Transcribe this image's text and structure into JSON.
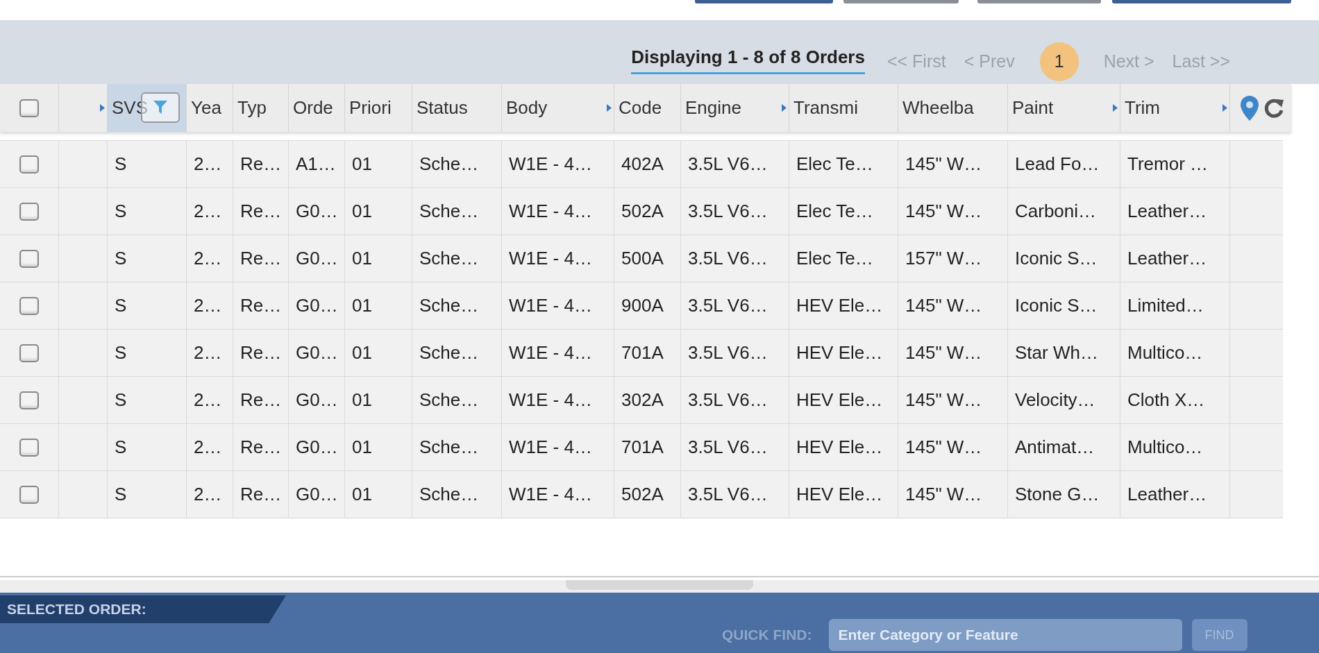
{
  "top_buttons": [
    {
      "kind": "primary"
    },
    {
      "kind": "secondary"
    },
    {
      "kind": "secondary"
    },
    {
      "kind": "primary"
    }
  ],
  "pager": {
    "summary": "Displaying 1 - 8 of 8 Orders",
    "first": "<< First",
    "prev": "< Prev",
    "pages": [
      {
        "label": "1",
        "selected": true
      }
    ],
    "next": "Next >",
    "last": "Last >>"
  },
  "table": {
    "header_checked": false,
    "columns": [
      {
        "sort_arrow": true,
        "selected": false
      },
      {
        "label": "SVS",
        "sort_arrow": false,
        "selected": true
      },
      {
        "label": "Yea",
        "sort_arrow": false,
        "selected": false
      },
      {
        "label": "Typ",
        "sort_arrow": false,
        "selected": false
      },
      {
        "label": "Orde",
        "sort_arrow": false,
        "selected": false
      },
      {
        "label": "Priori",
        "sort_arrow": false,
        "selected": false
      },
      {
        "label": "Status",
        "sort_arrow": false,
        "selected": false
      },
      {
        "label": "Body",
        "sort_arrow": true,
        "selected": false
      },
      {
        "label": "Code",
        "sort_arrow": false,
        "selected": false
      },
      {
        "label": "Engine",
        "sort_arrow": true,
        "selected": false
      },
      {
        "label": "Transmi",
        "sort_arrow": false,
        "selected": false
      },
      {
        "label": "Wheelba",
        "sort_arrow": false,
        "selected": false
      },
      {
        "label": "Paint",
        "sort_arrow": true,
        "selected": false
      },
      {
        "label": "Trim",
        "sort_arrow": true,
        "selected": false
      }
    ],
    "rows": [
      {
        "checked": false,
        "cells": [
          "",
          "S",
          "2…",
          "Re…",
          "A1…",
          "01",
          "Sche…",
          "W1E - 4…",
          "402A",
          "3.5L V6…",
          "Elec Te…",
          "145\" W…",
          "Lead Fo…",
          "Tremor …"
        ]
      },
      {
        "checked": false,
        "cells": [
          "",
          "S",
          "2…",
          "Re…",
          "G0…",
          "01",
          "Sche…",
          "W1E - 4…",
          "502A",
          "3.5L V6…",
          "Elec Te…",
          "145\" W…",
          "Carboni…",
          "Leather…"
        ]
      },
      {
        "checked": false,
        "cells": [
          "",
          "S",
          "2…",
          "Re…",
          "G0…",
          "01",
          "Sche…",
          "W1E - 4…",
          "500A",
          "3.5L V6…",
          "Elec Te…",
          "157\" W…",
          "Iconic S…",
          "Leather…"
        ]
      },
      {
        "checked": false,
        "cells": [
          "",
          "S",
          "2…",
          "Re…",
          "G0…",
          "01",
          "Sche…",
          "W1E - 4…",
          "900A",
          "3.5L V6…",
          "HEV Ele…",
          "145\" W…",
          "Iconic S…",
          "Limited…"
        ]
      },
      {
        "checked": false,
        "cells": [
          "",
          "S",
          "2…",
          "Re…",
          "G0…",
          "01",
          "Sche…",
          "W1E - 4…",
          "701A",
          "3.5L V6…",
          "HEV Ele…",
          "145\" W…",
          "Star Wh…",
          "Multico…"
        ]
      },
      {
        "checked": false,
        "cells": [
          "",
          "S",
          "2…",
          "Re…",
          "G0…",
          "01",
          "Sche…",
          "W1E - 4…",
          "302A",
          "3.5L V6…",
          "HEV Ele…",
          "145\" W…",
          "Velocity…",
          "Cloth X…"
        ]
      },
      {
        "checked": false,
        "cells": [
          "",
          "S",
          "2…",
          "Re…",
          "G0…",
          "01",
          "Sche…",
          "W1E - 4…",
          "701A",
          "3.5L V6…",
          "HEV Ele…",
          "145\" W…",
          "Antimat…",
          "Multico…"
        ]
      },
      {
        "checked": false,
        "cells": [
          "",
          "S",
          "2…",
          "Re…",
          "G0…",
          "01",
          "Sche…",
          "W1E - 4…",
          "502A",
          "3.5L V6…",
          "HEV Ele…",
          "145\" W…",
          "Stone G…",
          "Leather…"
        ]
      }
    ]
  },
  "bottom_bar": {
    "selected_order_label": "SELECTED ORDER:",
    "quick_find_label": "QUICK FIND:",
    "quick_find": {
      "placeholder": "Enter Category or Feature"
    },
    "find_button": "FIND"
  }
}
